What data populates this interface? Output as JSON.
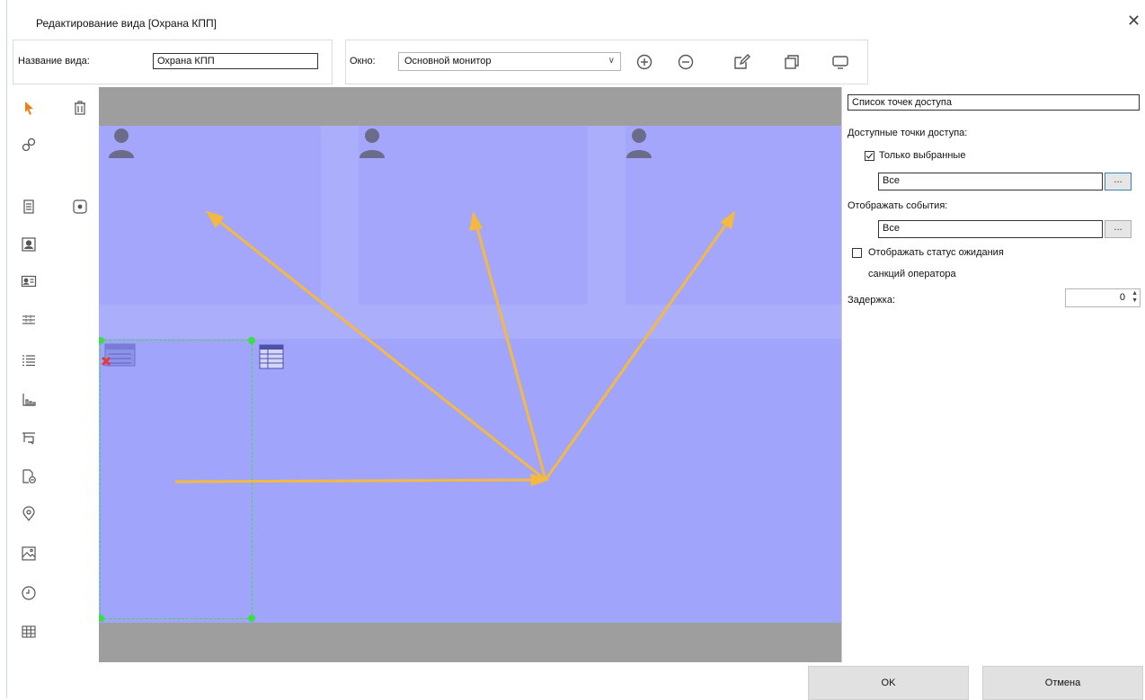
{
  "window": {
    "title": "Редактирование вида [Охрана КПП]",
    "close_glyph": "✕"
  },
  "toolbar": {
    "view_name_label": "Название вида:",
    "view_name_value": "Охрана КПП",
    "window_label": "Окно:",
    "window_value": "Основной монитор",
    "icons": [
      "zoom-in-icon",
      "zoom-out-icon",
      "edit-icon",
      "copy-icon",
      "monitor-icon"
    ]
  },
  "sidebar": {
    "tools": [
      "cursor-icon",
      "trash-icon",
      "link-icon",
      "document-icon",
      "point-icon",
      "person-photo-icon",
      "id-card-icon",
      "table-rows-icon",
      "list-icon",
      "chart-icon",
      "gauge-icon",
      "document-add-icon",
      "map-marker-icon",
      "image-icon",
      "clock-icon",
      "grid-icon"
    ]
  },
  "properties": {
    "header_value": "Список точек доступа",
    "available_points_label": "Доступные точки доступа:",
    "only_selected_label": "Только выбранные",
    "only_selected_checked": true,
    "points_value": "Все",
    "dots_label": "...",
    "show_events_label": "Отображать события:",
    "events_value": "Все",
    "show_status_label_1": "Отображать статус ожидания",
    "show_status_label_2": "санкций оператора",
    "show_status_checked": false,
    "delay_label": "Задержка:",
    "delay_value": "0"
  },
  "buttons": {
    "ok": "OK",
    "cancel": "Отмена"
  },
  "colors": {
    "canvas_bg": "#9e9e9e",
    "layout_bg": "#abaefb",
    "arrow": "#f4b942",
    "selection": "#3ddc4a",
    "cursor": "#f07d1e"
  }
}
